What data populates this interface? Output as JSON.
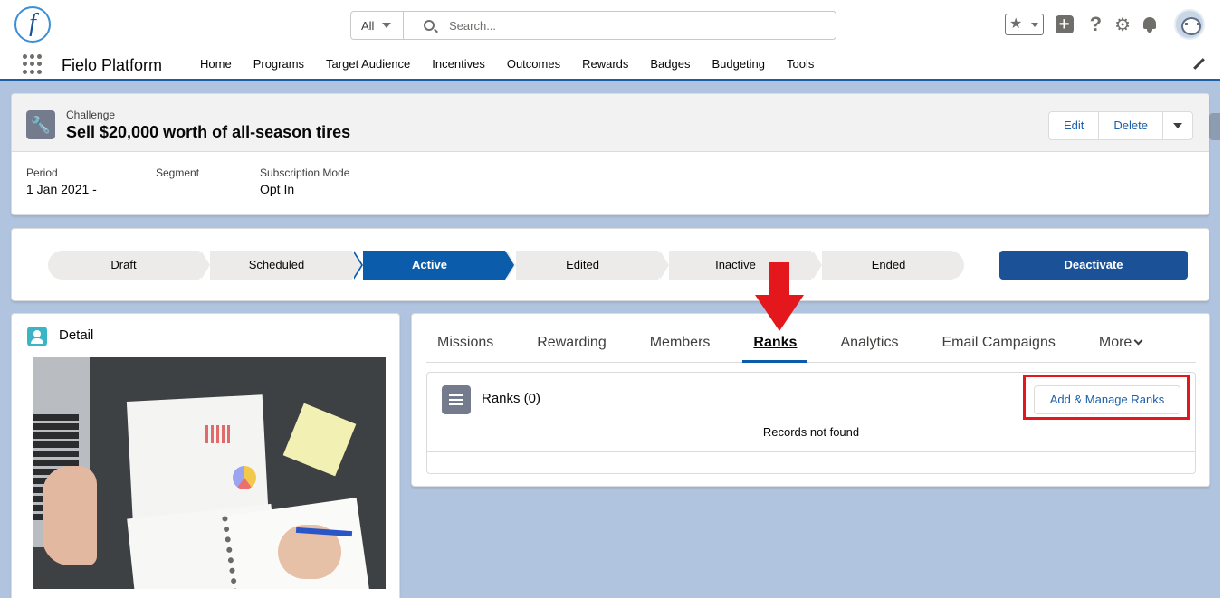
{
  "header": {
    "logo_letter": "f",
    "search_scope": "All",
    "search_placeholder": "Search..."
  },
  "nav": {
    "app_name": "Fielo Platform",
    "items": [
      "Home",
      "Programs",
      "Target Audience",
      "Incentives",
      "Outcomes",
      "Rewards",
      "Badges",
      "Budgeting",
      "Tools"
    ]
  },
  "record": {
    "type": "Challenge",
    "title": "Sell $20,000 worth of all-season tires",
    "edit_label": "Edit",
    "delete_label": "Delete",
    "fields": [
      {
        "label": "Period",
        "value": "1 Jan 2021 -"
      },
      {
        "label": "Segment",
        "value": ""
      },
      {
        "label": "Subscription Mode",
        "value": "Opt In"
      }
    ]
  },
  "path": {
    "stages": [
      "Draft",
      "Scheduled",
      "Active",
      "Edited",
      "Inactive",
      "Ended"
    ],
    "active_stage": "Active",
    "action_label": "Deactivate"
  },
  "detail": {
    "title": "Detail"
  },
  "tabs": {
    "items": [
      "Missions",
      "Rewarding",
      "Members",
      "Ranks",
      "Analytics",
      "Email Campaigns"
    ],
    "more_label": "More",
    "active": "Ranks"
  },
  "ranks": {
    "title": "Ranks (0)",
    "add_label": "Add & Manage Ranks",
    "empty_text": "Records not found"
  },
  "colors": {
    "brand": "#1b5297",
    "active_stage": "#0b5cab",
    "annotation_red": "#e3171c"
  }
}
